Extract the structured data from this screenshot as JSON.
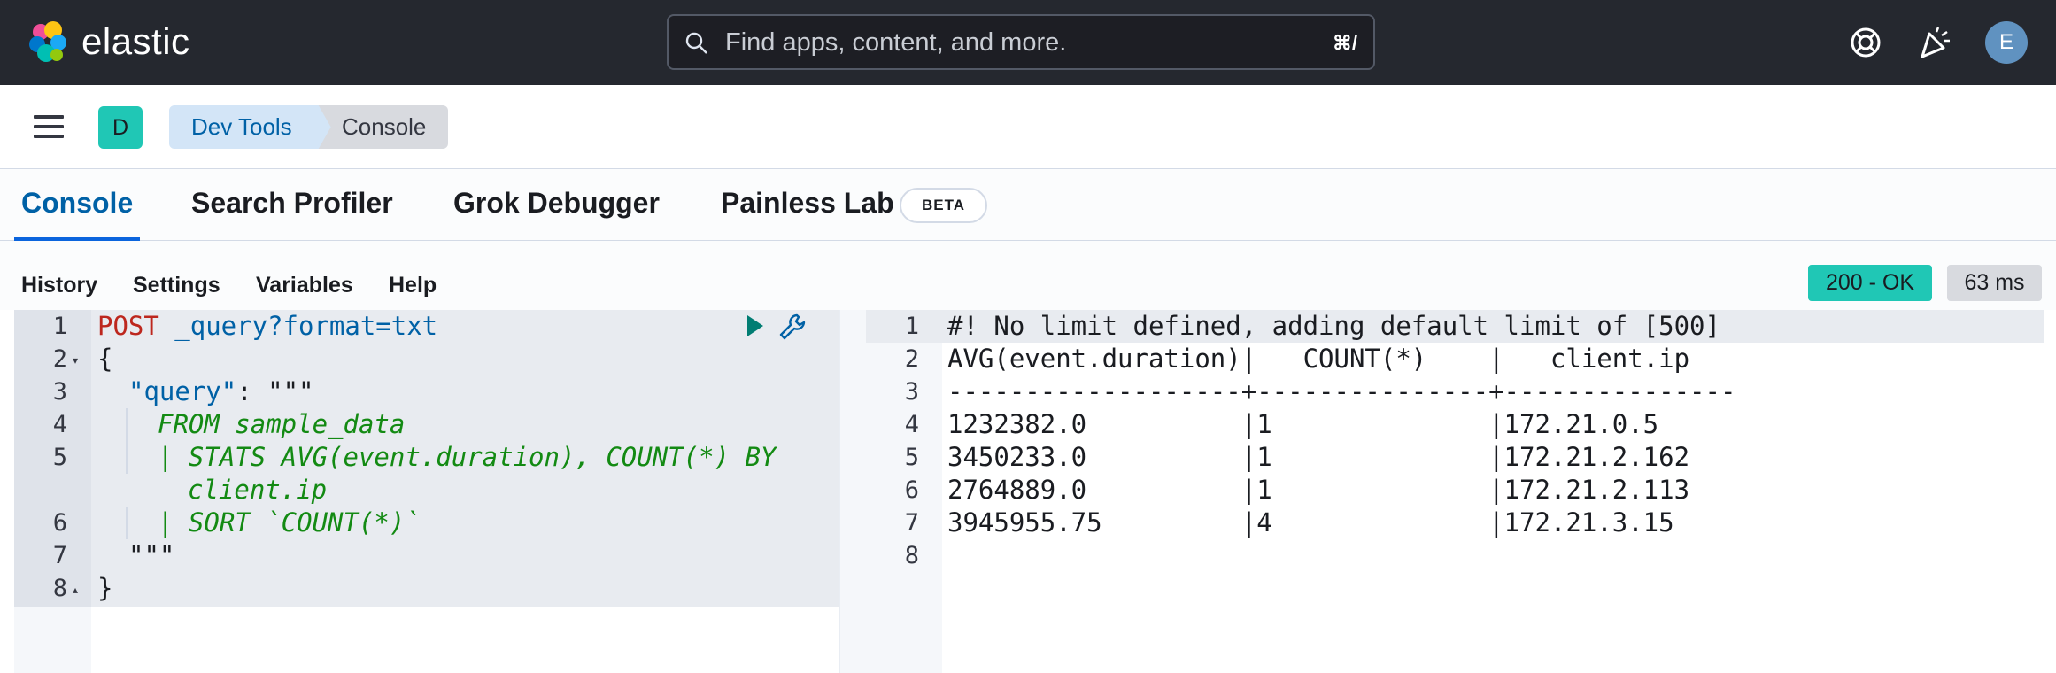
{
  "header": {
    "logo_text": "elastic",
    "search_placeholder": "Find apps, content, and more.",
    "search_shortcut": "⌘/",
    "avatar_initial": "E"
  },
  "nav": {
    "space_initial": "D",
    "breadcrumbs": [
      "Dev Tools",
      "Console"
    ]
  },
  "tabs": [
    {
      "label": "Console",
      "active": true
    },
    {
      "label": "Search Profiler"
    },
    {
      "label": "Grok Debugger"
    },
    {
      "label": "Painless Lab",
      "badge": "BETA"
    }
  ],
  "toolbar": {
    "items": [
      "History",
      "Settings",
      "Variables",
      "Help"
    ],
    "status": "200 - OK",
    "time": "63 ms"
  },
  "request": {
    "line_numbers": [
      "1",
      "2",
      "3",
      "4",
      "5",
      "",
      "6",
      "7",
      "8"
    ],
    "method": "POST",
    "path": " _query?format=txt",
    "lines": [
      "{",
      "\"query\"",
      ": \"\"\"",
      "FROM sample_data",
      "| STATS AVG(event.duration), COUNT(*) BY",
      "client.ip",
      "| SORT `COUNT(*)`",
      "\"\"\"",
      "}"
    ]
  },
  "response": {
    "line_numbers": [
      "1",
      "2",
      "3",
      "4",
      "5",
      "6",
      "7",
      "8"
    ],
    "lines": [
      "#! No limit defined, adding default limit of [500]",
      "AVG(event.duration)|   COUNT(*)    |   client.ip   ",
      "-------------------+---------------+---------------",
      "1232382.0          |1              |172.21.0.5     ",
      "3450233.0          |1              |172.21.2.162   ",
      "2764889.0          |1              |172.21.2.113   ",
      "3945955.75         |4              |172.21.3.15    ",
      ""
    ]
  },
  "colors": {
    "header_bg": "#25282f",
    "accent": "#0061a6",
    "status_ok": "#20c7b5",
    "string_green": "#138a13",
    "method_red": "#bd271e"
  }
}
